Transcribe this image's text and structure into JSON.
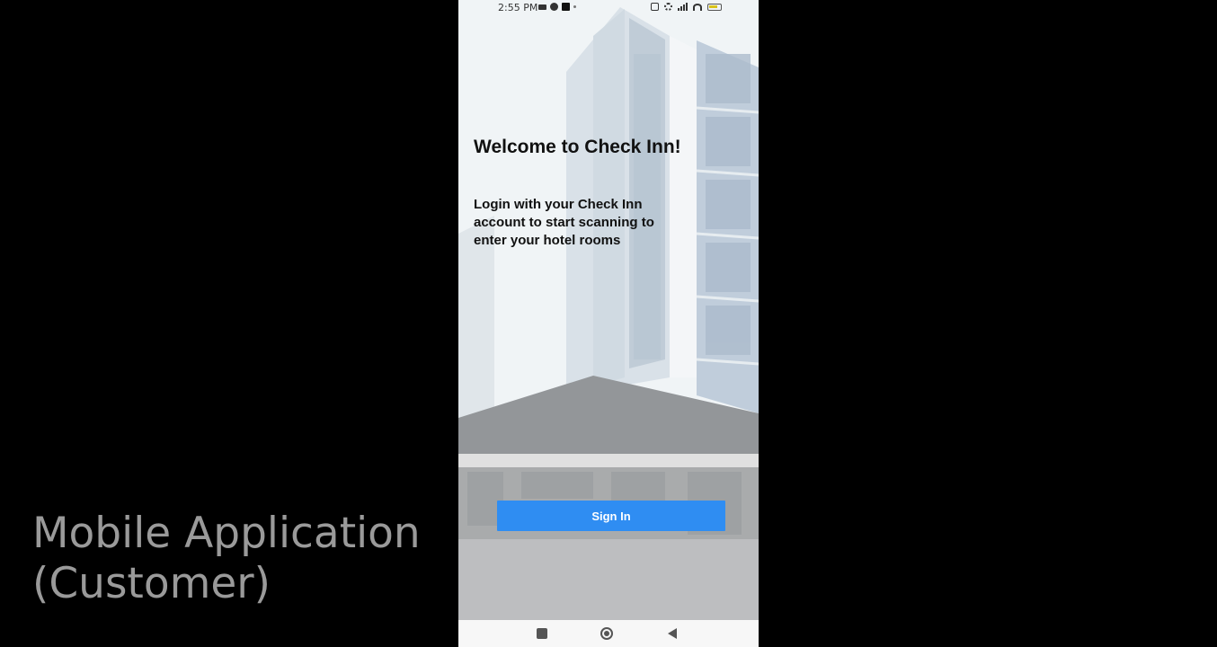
{
  "caption": {
    "line1": "Mobile Application",
    "line2": "(Customer)"
  },
  "status_bar": {
    "time": "2:55 PM"
  },
  "screen": {
    "welcome_title": "Welcome to Check Inn!",
    "subtitle": "Login with your Check Inn account to start scanning to enter your hotel rooms",
    "sign_in_label": "Sign In"
  },
  "nav_bar": {
    "icons": [
      "recent-apps-icon",
      "home-icon",
      "back-icon"
    ]
  },
  "colors": {
    "primary_button": "#2f8df2",
    "background": "#000000",
    "caption_text": "#9a9a9a"
  }
}
